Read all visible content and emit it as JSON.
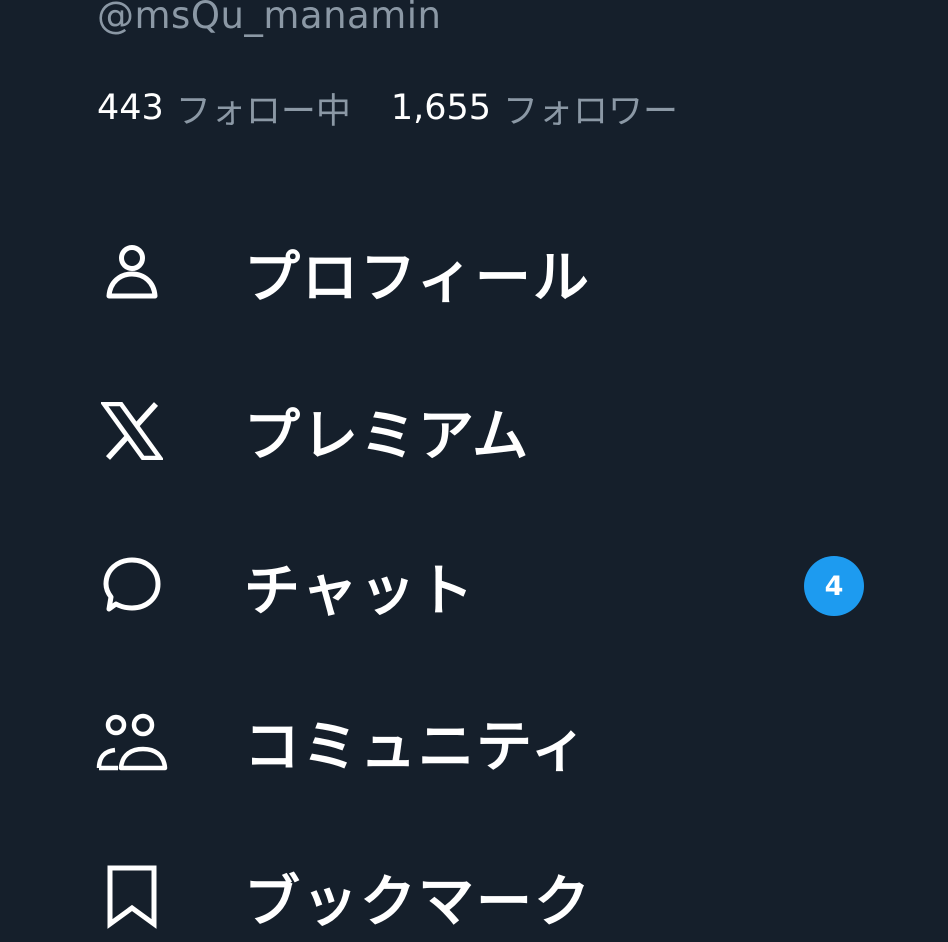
{
  "profile": {
    "handle": "@msQu_manamin",
    "following_count": "443",
    "following_label": "フォロー中",
    "followers_count": "1,655",
    "followers_label": "フォロワー"
  },
  "menu": {
    "items": [
      {
        "label": "プロフィール",
        "icon": "person-icon"
      },
      {
        "label": "プレミアム",
        "icon": "x-logo-icon"
      },
      {
        "label": "チャット",
        "icon": "chat-bubble-icon",
        "badge": "4"
      },
      {
        "label": "コミュニティ",
        "icon": "people-icon"
      },
      {
        "label": "ブックマーク",
        "icon": "bookmark-icon"
      }
    ]
  },
  "colors": {
    "background": "#151f2b",
    "text_primary": "#ffffff",
    "text_secondary": "#8b98a5",
    "badge": "#1d9bf0"
  }
}
